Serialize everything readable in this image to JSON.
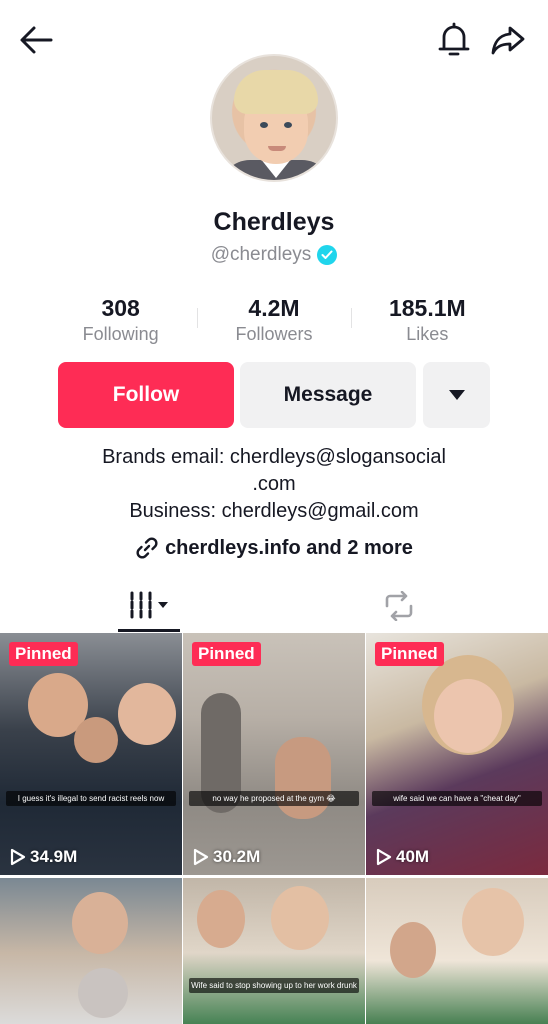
{
  "header": {
    "back_icon": "arrow-left-icon",
    "notifications_icon": "bell-icon",
    "share_icon": "share-arrow-icon"
  },
  "profile": {
    "display_name": "Cherdleys",
    "handle": "@cherdleys",
    "verified": true
  },
  "stats": [
    {
      "value": "308",
      "label": "Following"
    },
    {
      "value": "4.2M",
      "label": "Followers"
    },
    {
      "value": "185.1M",
      "label": "Likes"
    }
  ],
  "actions": {
    "follow_label": "Follow",
    "message_label": "Message",
    "more_icon": "caret-down-icon"
  },
  "bio": {
    "line1": "Brands email: cherdleys@slogansocial",
    "line2": ".com",
    "line3": "Business: cherdleys@gmail.com",
    "link": "cherdleys.info and 2 more"
  },
  "tabs": [
    {
      "name": "videos",
      "icon": "grid-icon",
      "active": true
    },
    {
      "name": "reposts",
      "icon": "repost-icon",
      "active": false
    }
  ],
  "videos": [
    {
      "pinned": "Pinned",
      "views": "34.9M",
      "caption": "I guess it's illegal to send racist reels now"
    },
    {
      "pinned": "Pinned",
      "views": "30.2M",
      "caption": "no way he proposed at the gym 😂"
    },
    {
      "pinned": "Pinned",
      "views": "40M",
      "caption": "wife said we can have a \"cheat day\""
    },
    {
      "pinned": "",
      "views": "",
      "caption": ""
    },
    {
      "pinned": "",
      "views": "",
      "caption": "Wife said to stop showing up to her work drunk"
    },
    {
      "pinned": "",
      "views": "",
      "caption": ""
    }
  ],
  "colors": {
    "accent": "#fe2c55",
    "verified": "#20d5ec",
    "secondary_text": "#8a8b91",
    "button_bg": "#f1f1f2"
  }
}
